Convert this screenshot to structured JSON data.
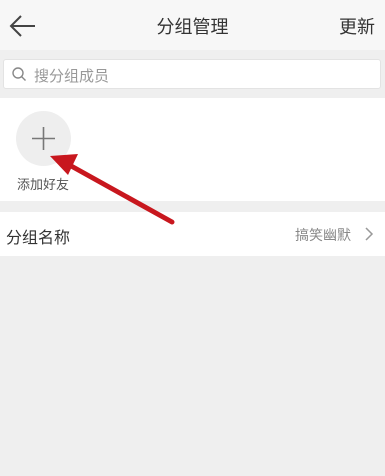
{
  "header": {
    "title": "分组管理",
    "update_label": "更新"
  },
  "search": {
    "placeholder": "搜分组成员"
  },
  "members": {
    "add_friend_label": "添加好友"
  },
  "group": {
    "name_label": "分组名称",
    "name_value": "搞笑幽默"
  },
  "colors": {
    "annotation_arrow": "#c8171e",
    "background": "#efefef",
    "panel": "#ffffff"
  },
  "icons": {
    "back": "back-arrow-icon",
    "search": "search-icon",
    "add": "plus-icon",
    "chevron": "chevron-right-icon"
  }
}
